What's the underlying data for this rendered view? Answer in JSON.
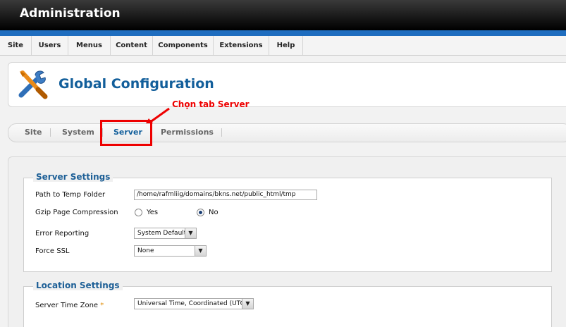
{
  "app": {
    "title": "Administration"
  },
  "menu": {
    "items": [
      {
        "label": "Site"
      },
      {
        "label": "Users"
      },
      {
        "label": "Menus"
      },
      {
        "label": "Content"
      },
      {
        "label": "Components"
      },
      {
        "label": "Extensions"
      },
      {
        "label": "Help"
      }
    ]
  },
  "page": {
    "title": "Global Configuration"
  },
  "annotation": {
    "text": "Chọn tab Server",
    "color": "#e00000"
  },
  "tabs": [
    {
      "label": "Site",
      "active": false
    },
    {
      "label": "System",
      "active": false
    },
    {
      "label": "Server",
      "active": true
    },
    {
      "label": "Permissions",
      "active": false
    }
  ],
  "server_settings": {
    "legend": "Server Settings",
    "path_to_temp": {
      "label": "Path to Temp Folder",
      "value": "/home/rafmliig/domains/bkns.net/public_html/tmp"
    },
    "gzip": {
      "label": "Gzip Page Compression",
      "options": [
        "Yes",
        "No"
      ],
      "selected": "No"
    },
    "error_reporting": {
      "label": "Error Reporting",
      "value": "System Default"
    },
    "force_ssl": {
      "label": "Force SSL",
      "value": "None"
    }
  },
  "location_settings": {
    "legend": "Location Settings",
    "timezone": {
      "label": "Server Time Zone",
      "required_marker": "*",
      "value": "Universal Time, Coordinated (UTC)"
    }
  },
  "colors": {
    "accent": "#1e6dbf",
    "title": "#135f9b",
    "highlight": "#e00000"
  }
}
